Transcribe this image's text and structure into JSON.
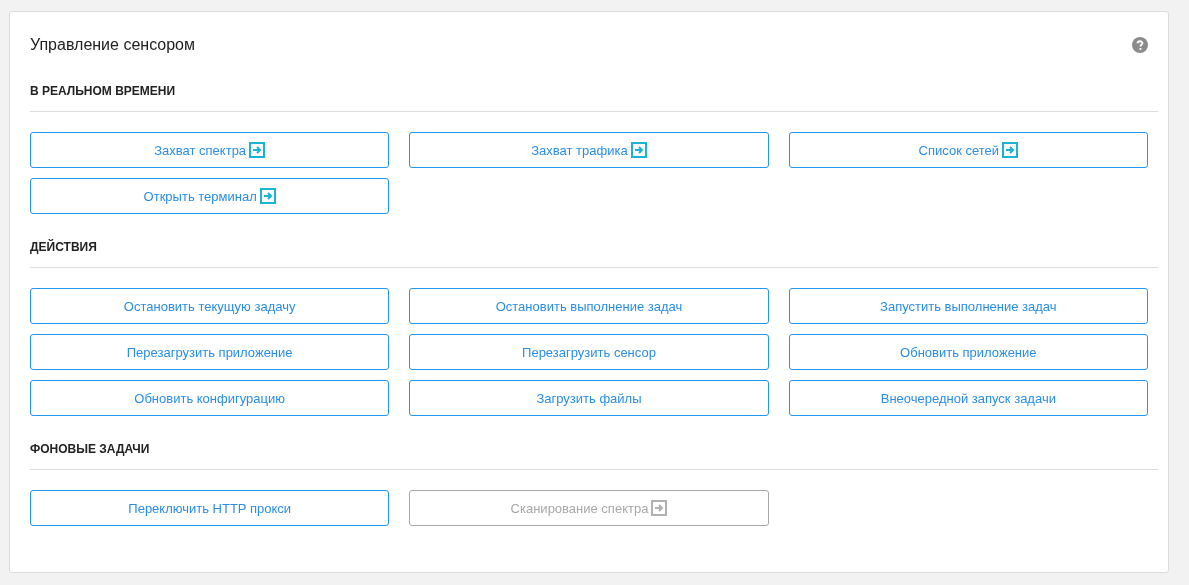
{
  "panel": {
    "title": "Управление сенсором"
  },
  "sections": [
    {
      "title": "В РЕАЛЬНОМ ВРЕМЕНИ",
      "buttons": [
        {
          "label": "Захват спектра",
          "opens_window": true,
          "disabled": false
        },
        {
          "label": "Захват трафика",
          "opens_window": true,
          "disabled": false
        },
        {
          "label": "Список сетей",
          "opens_window": true,
          "disabled": false
        },
        {
          "label": "Открыть терминал",
          "opens_window": true,
          "disabled": false
        }
      ]
    },
    {
      "title": "ДЕЙСТВИЯ",
      "buttons": [
        {
          "label": "Остановить текущую задачу",
          "opens_window": false,
          "disabled": false
        },
        {
          "label": "Остановить выполнение задач",
          "opens_window": false,
          "disabled": false
        },
        {
          "label": "Запустить выполнение задач",
          "opens_window": false,
          "disabled": false
        },
        {
          "label": "Перезагрузить приложение",
          "opens_window": false,
          "disabled": false
        },
        {
          "label": "Перезагрузить сенсор",
          "opens_window": false,
          "disabled": false
        },
        {
          "label": "Обновить приложение",
          "opens_window": false,
          "disabled": false
        },
        {
          "label": "Обновить конфигурацию",
          "opens_window": false,
          "disabled": false
        },
        {
          "label": "Загрузить файлы",
          "opens_window": false,
          "disabled": false
        },
        {
          "label": "Внеочередной запуск задачи",
          "opens_window": false,
          "disabled": false
        }
      ]
    },
    {
      "title": "ФОНОВЫЕ ЗАДАЧИ",
      "buttons": [
        {
          "label": "Переключить HTTP прокси",
          "opens_window": false,
          "disabled": false
        },
        {
          "label": "Сканирование спектра",
          "opens_window": true,
          "disabled": true
        }
      ]
    }
  ]
}
